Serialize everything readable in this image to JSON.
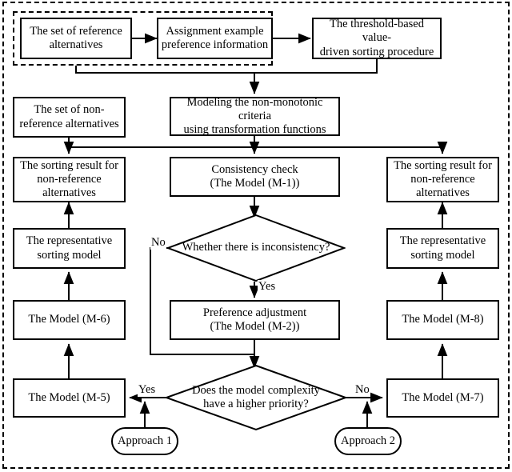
{
  "diagram": {
    "title": "Threshold-based value-driven sorting procedure flowchart",
    "nodes": {
      "reference_set": "The set of reference\nalternatives",
      "assignment_example": "Assignment example\npreference information",
      "threshold_procedure": "The threshold-based value-\ndriven sorting procedure",
      "nonreference_set": "The set of non-\nreference alternatives",
      "modeling_criteria": "Modeling the non-monotonic criteria\nusing transformation functions",
      "sorting_result_left": "The sorting result for\nnon-reference\nalternatives",
      "consistency_check": "Consistency check\n(The Model (M-1))",
      "sorting_result_right": "The sorting result for\nnon-reference\nalternatives",
      "representative_model_left": "The representative\nsorting model",
      "representative_model_right": "The representative\nsorting model",
      "model_m6": "The Model (M-6)",
      "model_m8": "The Model (M-8)",
      "preference_adjustment": "Preference adjustment\n(The Model (M-2))",
      "model_m5": "The Model (M-5)",
      "model_m7": "The Model (M-7)",
      "approach_1": "Approach 1",
      "approach_2": "Approach 2"
    },
    "decisions": {
      "inconsistency": "Whether there is inconsistency?",
      "complexity": "Does the model complexity\nhave a higher priority?"
    },
    "edge_labels": {
      "inconsistency_no": "No",
      "inconsistency_yes": "Yes",
      "complexity_yes": "Yes",
      "complexity_no": "No"
    },
    "colors": {
      "stroke": "#000000",
      "fill": "#ffffff",
      "background": "#ffffff"
    }
  }
}
